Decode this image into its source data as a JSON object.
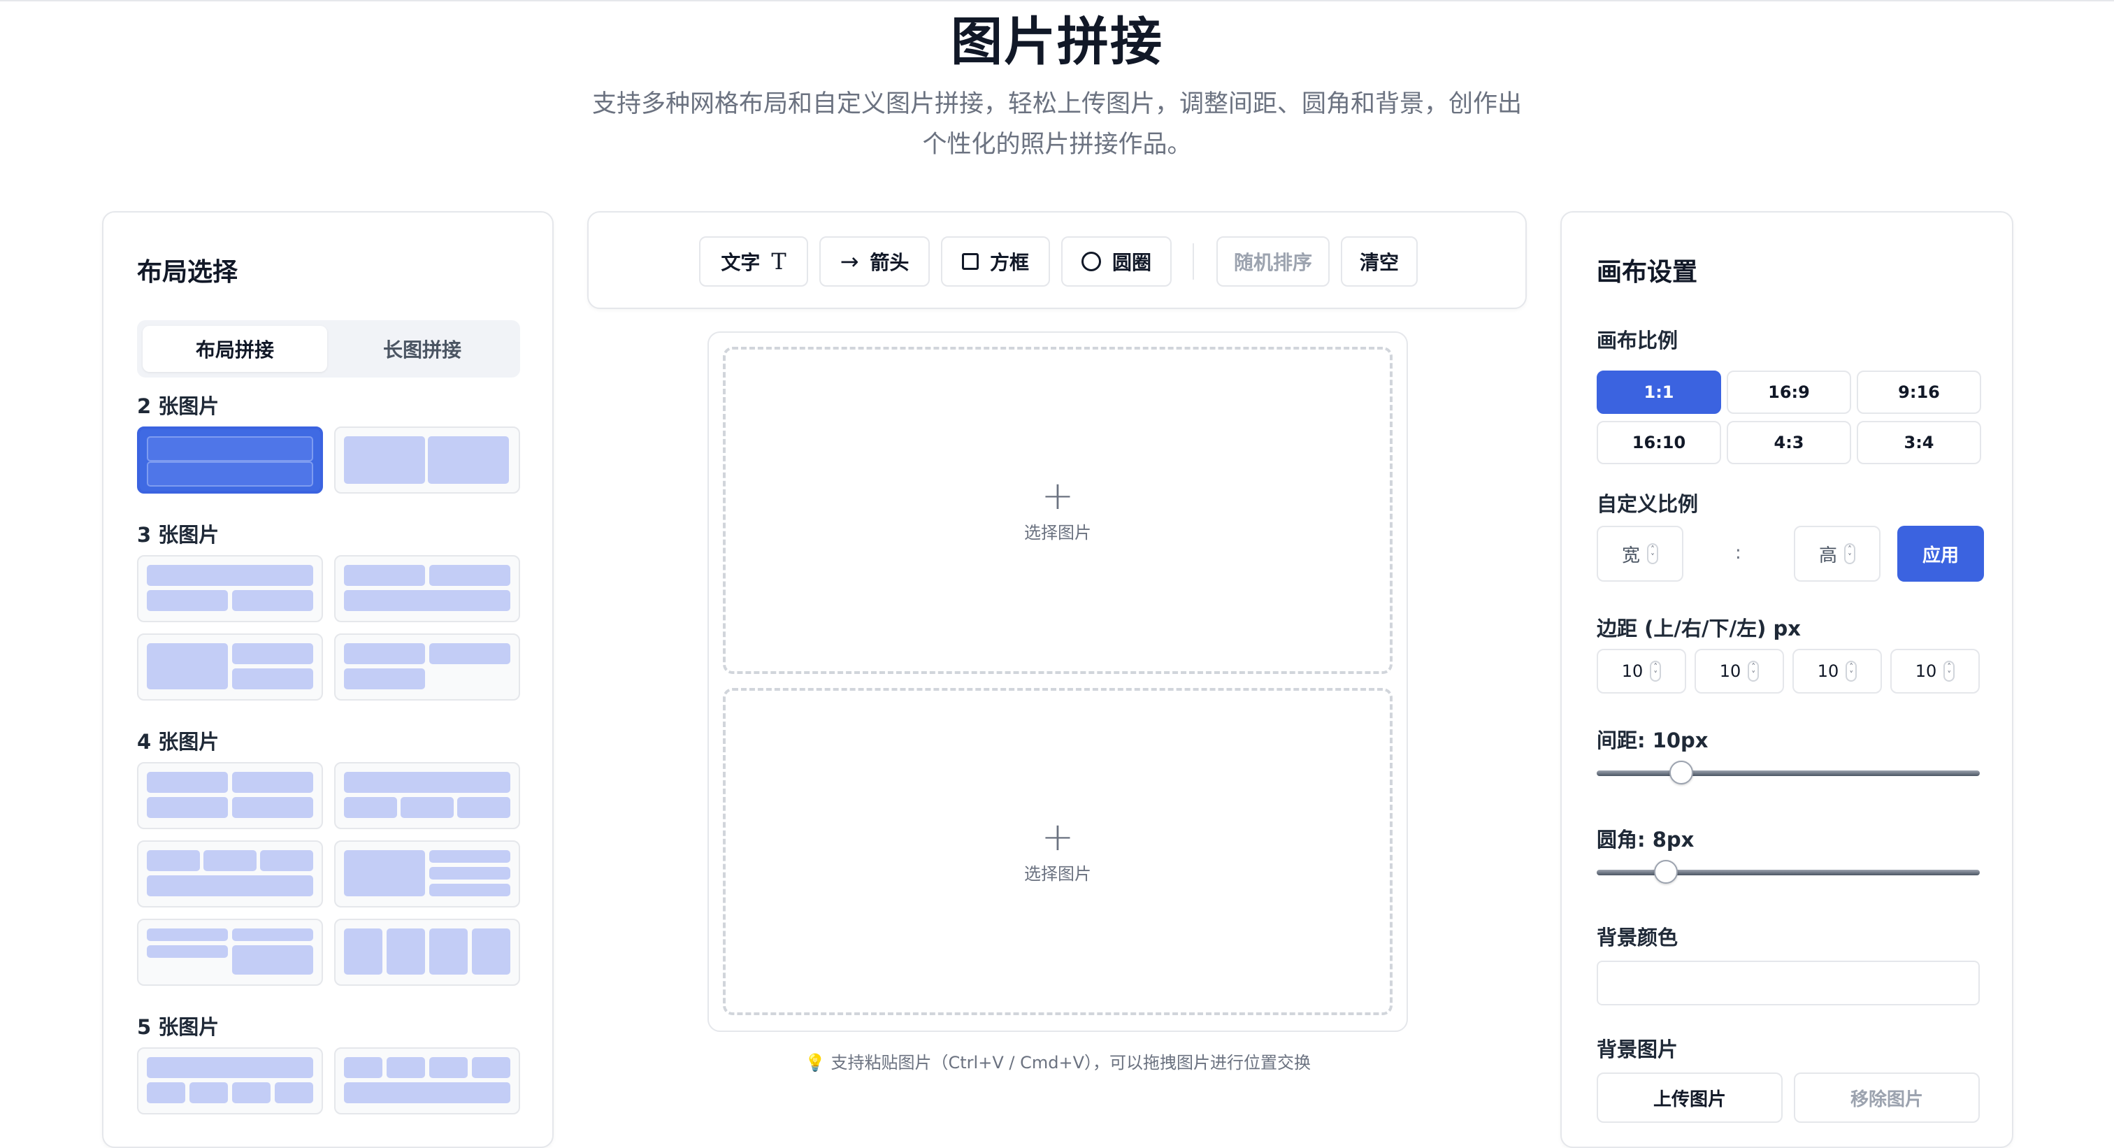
{
  "header": {
    "title": "图片拼接",
    "subtitle": "支持多种网格布局和自定义图片拼接，轻松上传图片，调整间距、圆角和背景，创作出个性化的照片拼接作品。"
  },
  "left": {
    "title": "布局选择",
    "tabs": [
      "布局拼接",
      "长图拼接"
    ],
    "groups": [
      "2 张图片",
      "3 张图片",
      "4 张图片",
      "5 张图片"
    ]
  },
  "toolbar": {
    "text": "文字",
    "text_icon": "T",
    "arrow": "箭头",
    "arrow_icon": "→",
    "box": "方框",
    "circle": "圆圈",
    "shuffle": "随机排序",
    "clear": "清空"
  },
  "canvas": {
    "slot_plus": "+",
    "slot_text": "选择图片",
    "hint_icon": "💡",
    "hint": "支持粘贴图片（Ctrl+V / Cmd+V），可以拖拽图片进行位置交换"
  },
  "right": {
    "title": "画布设置",
    "ratio_label": "画布比例",
    "ratios": [
      "1:1",
      "16:9",
      "9:16",
      "16:10",
      "4:3",
      "3:4"
    ],
    "selected_ratio": "1:1",
    "custom_label": "自定义比例",
    "width_placeholder": "宽",
    "height_placeholder": "高",
    "colon": ":",
    "apply": "应用",
    "margin_label": "边距 (上/右/下/左) px",
    "margins": [
      "10",
      "10",
      "10",
      "10"
    ],
    "gap_label": "间距: 10px",
    "gap_value": 10,
    "radius_label": "圆角: 8px",
    "radius_value": 8,
    "bg_color_label": "背景颜色",
    "bg_image_label": "背景图片",
    "upload": "上传图片",
    "remove": "移除图片"
  },
  "colors": {
    "accent": "#3b63e0",
    "cell": "#c3cdf6"
  }
}
